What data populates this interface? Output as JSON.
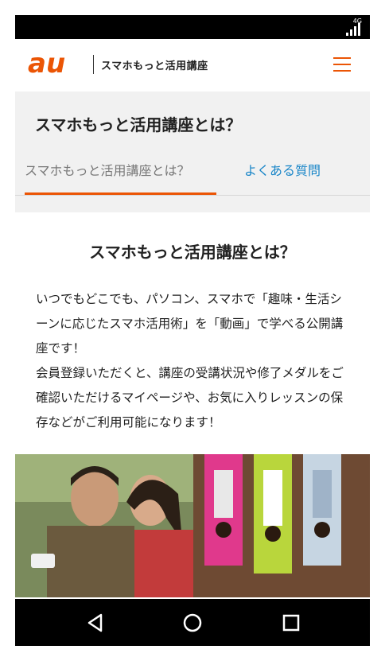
{
  "status": {
    "network": "4G"
  },
  "header": {
    "logo_text": "au",
    "site_title": "スマホもっと活用講座",
    "menu_icon": "hamburger-icon",
    "brand_color": "#eb5505"
  },
  "page": {
    "title": "スマホもっと活用講座とは？"
  },
  "tabs": [
    {
      "label": "スマホもっと活用講座とは？",
      "active": true
    },
    {
      "label": "よくある質問",
      "active": false
    }
  ],
  "card": {
    "title": "スマホもっと活用講座とは？",
    "paragraphs": [
      "いつでもどこでも、パソコン、スマホで「趣味・生活シーンに応じたスマホ活用術」を「動画」で学べる公開講座です！",
      "会員登録いただくと、講座の受講状況や修了メダルをご確認いただけるマイページや、お気に入りレッスンの保存などがご利用可能になります！"
    ]
  },
  "navbar": {
    "back_icon": "back-triangle-icon",
    "home_icon": "home-circle-icon",
    "recents_icon": "recents-square-icon"
  }
}
